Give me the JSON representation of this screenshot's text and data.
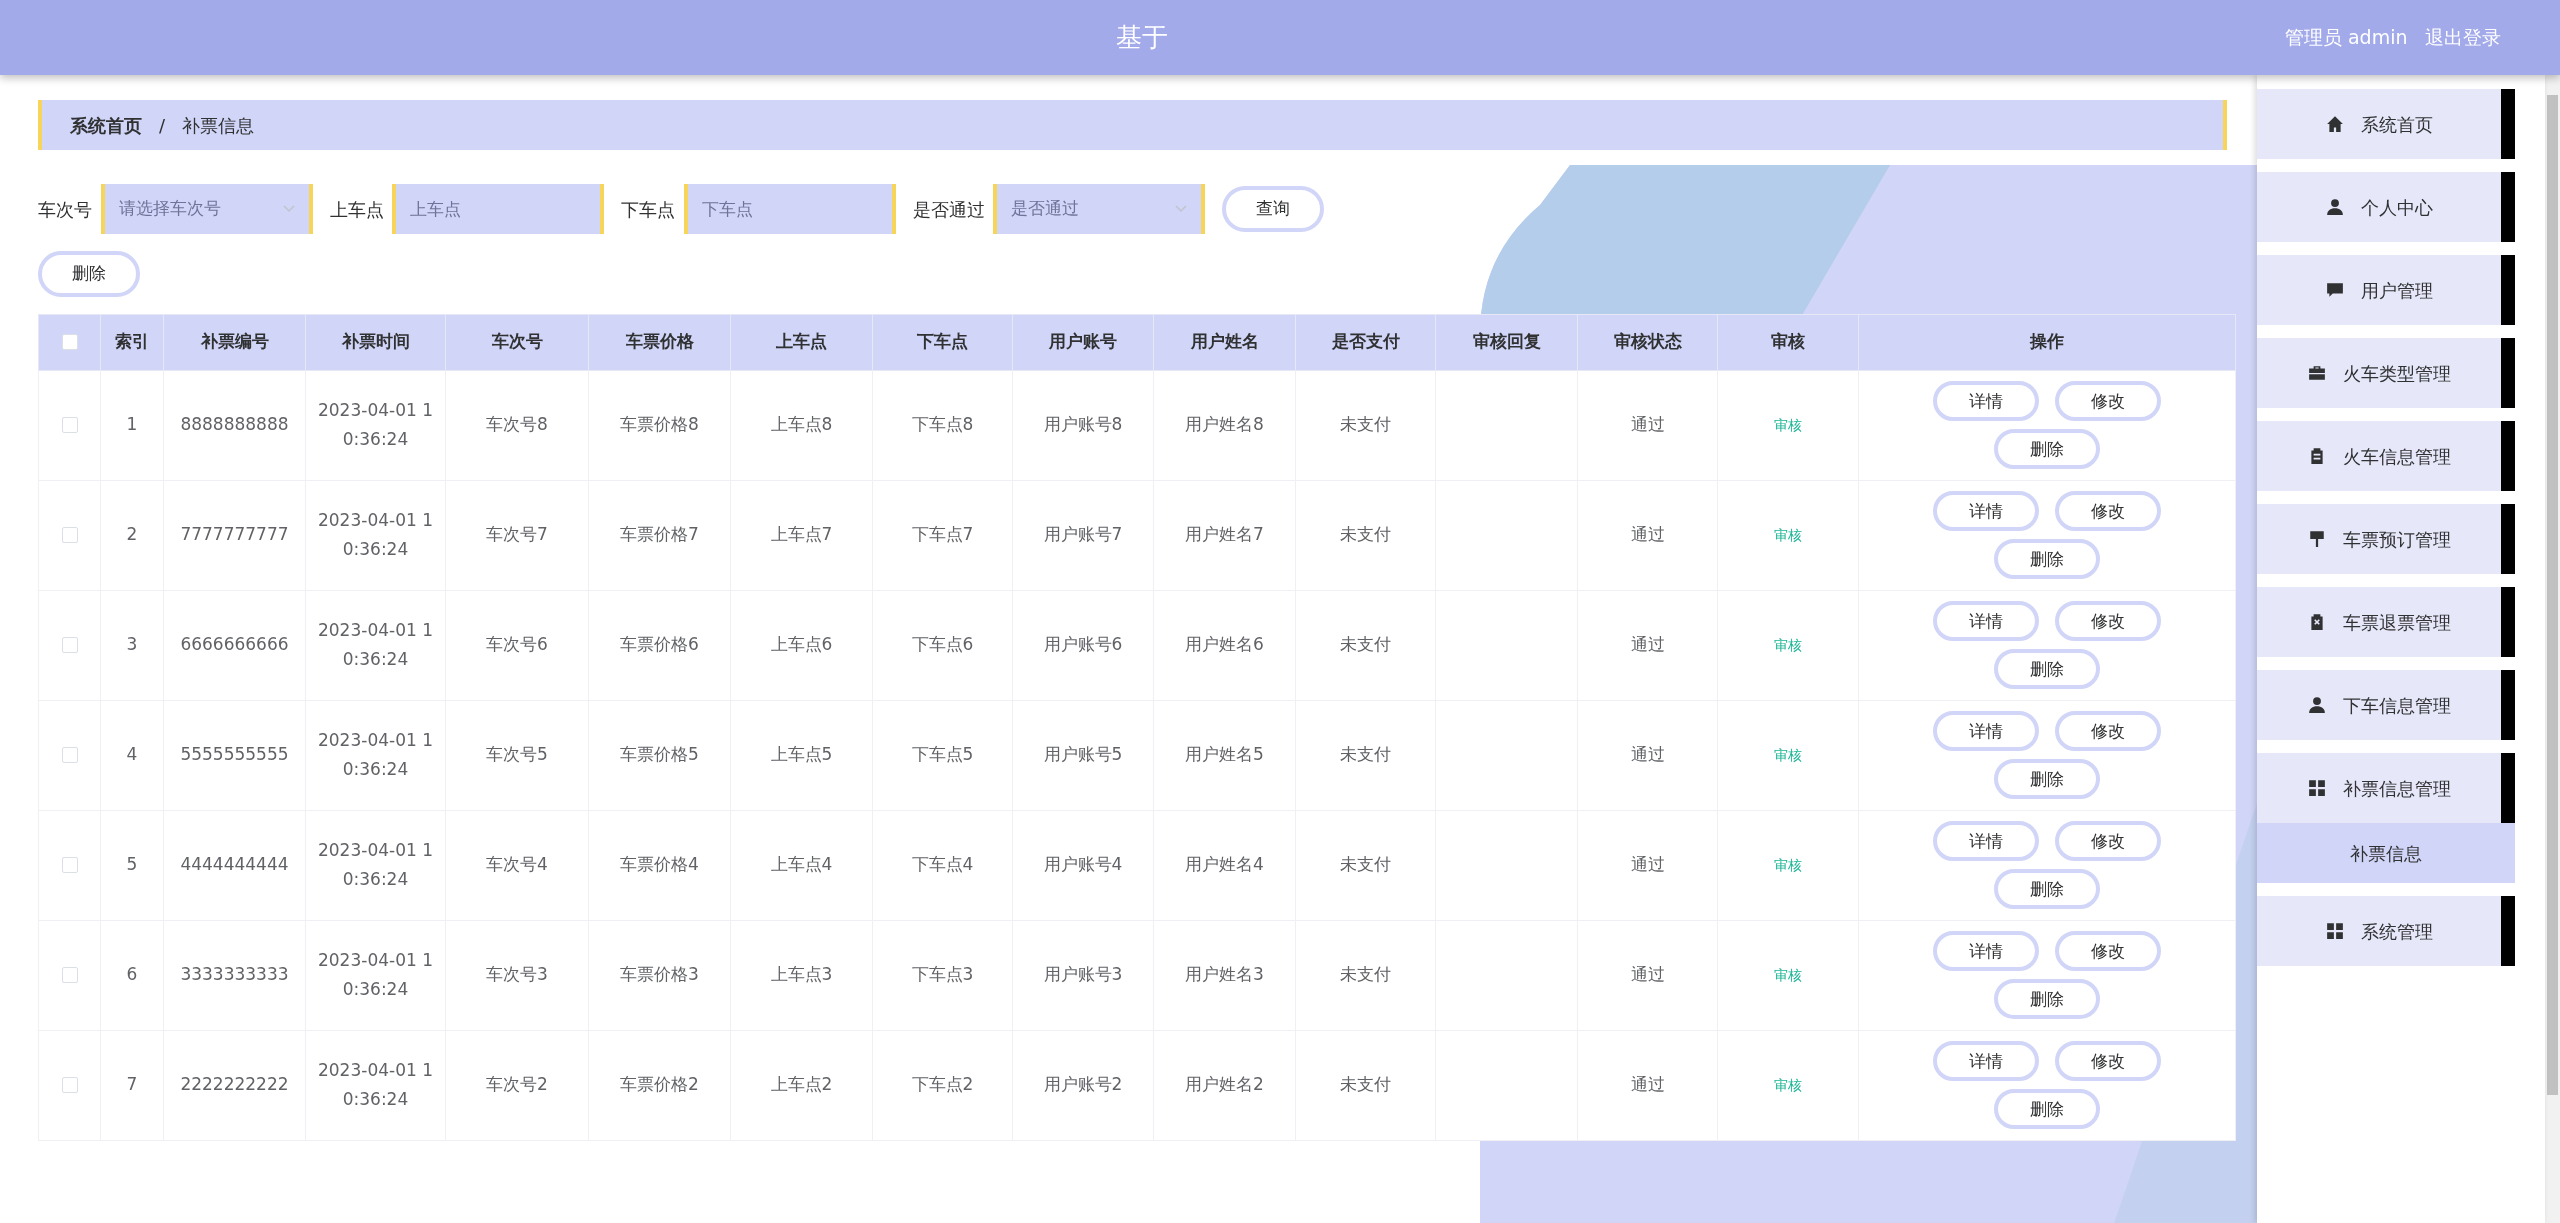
{
  "header": {
    "title": "基于",
    "user_label": "管理员 admin",
    "logout": "退出登录"
  },
  "breadcrumb": [
    {
      "label": "系统首页",
      "current": false
    },
    {
      "label": "补票信息",
      "current": true
    }
  ],
  "breadcrumb_separator": "/",
  "filters": [
    {
      "label": "车次号",
      "kind": "select",
      "placeholder": "请选择车次号"
    },
    {
      "label": "上车点",
      "kind": "input",
      "placeholder": "上车点"
    },
    {
      "label": "下车点",
      "kind": "input",
      "placeholder": "下车点"
    },
    {
      "label": "是否通过",
      "kind": "select",
      "placeholder": "是否通过"
    }
  ],
  "search_button": "查询",
  "delete_button": "删除",
  "table": {
    "select_all": {
      "checked": false
    },
    "columns": [
      "索引",
      "补票编号",
      "补票时间",
      "车次号",
      "车票价格",
      "上车点",
      "下车点",
      "用户账号",
      "用户姓名",
      "是否支付",
      "审核回复",
      "审核状态",
      "审核",
      "操作"
    ],
    "rows": [
      {
        "checked": false,
        "cells": [
          "1",
          "8888888888",
          "2023-04-01 10:36:24",
          "车次号8",
          "车票价格8",
          "上车点8",
          "下车点8",
          "用户账号8",
          "用户姓名8",
          "未支付",
          "",
          "通过"
        ],
        "review_link": "审核",
        "actions": [
          "详情",
          "修改",
          "删除"
        ]
      },
      {
        "checked": false,
        "cells": [
          "2",
          "7777777777",
          "2023-04-01 10:36:24",
          "车次号7",
          "车票价格7",
          "上车点7",
          "下车点7",
          "用户账号7",
          "用户姓名7",
          "未支付",
          "",
          "通过"
        ],
        "review_link": "审核",
        "actions": [
          "详情",
          "修改",
          "删除"
        ]
      },
      {
        "checked": false,
        "cells": [
          "3",
          "6666666666",
          "2023-04-01 10:36:24",
          "车次号6",
          "车票价格6",
          "上车点6",
          "下车点6",
          "用户账号6",
          "用户姓名6",
          "未支付",
          "",
          "通过"
        ],
        "review_link": "审核",
        "actions": [
          "详情",
          "修改",
          "删除"
        ]
      },
      {
        "checked": false,
        "cells": [
          "4",
          "5555555555",
          "2023-04-01 10:36:24",
          "车次号5",
          "车票价格5",
          "上车点5",
          "下车点5",
          "用户账号5",
          "用户姓名5",
          "未支付",
          "",
          "通过"
        ],
        "review_link": "审核",
        "actions": [
          "详情",
          "修改",
          "删除"
        ]
      },
      {
        "checked": false,
        "cells": [
          "5",
          "4444444444",
          "2023-04-01 10:36:24",
          "车次号4",
          "车票价格4",
          "上车点4",
          "下车点4",
          "用户账号4",
          "用户姓名4",
          "未支付",
          "",
          "通过"
        ],
        "review_link": "审核",
        "actions": [
          "详情",
          "修改",
          "删除"
        ]
      },
      {
        "checked": false,
        "cells": [
          "6",
          "3333333333",
          "2023-04-01 10:36:24",
          "车次号3",
          "车票价格3",
          "上车点3",
          "下车点3",
          "用户账号3",
          "用户姓名3",
          "未支付",
          "",
          "通过"
        ],
        "review_link": "审核",
        "actions": [
          "详情",
          "修改",
          "删除"
        ]
      },
      {
        "checked": false,
        "cells": [
          "7",
          "2222222222",
          "2023-04-01 10:36:24",
          "车次号2",
          "车票价格2",
          "上车点2",
          "下车点2",
          "用户账号2",
          "用户姓名2",
          "未支付",
          "",
          "通过"
        ],
        "review_link": "审核",
        "actions": [
          "详情",
          "修改",
          "删除"
        ]
      }
    ]
  },
  "sidebar": {
    "items": [
      {
        "label": "系统首页",
        "expanded": false
      },
      {
        "label": "个人中心",
        "expanded": false
      },
      {
        "label": "用户管理",
        "expanded": false
      },
      {
        "label": "火车类型管理",
        "expanded": false
      },
      {
        "label": "火车信息管理",
        "expanded": false
      },
      {
        "label": "车票预订管理",
        "expanded": false
      },
      {
        "label": "车票退票管理",
        "expanded": false
      },
      {
        "label": "下车信息管理",
        "expanded": false
      },
      {
        "label": "补票信息管理",
        "expanded": true,
        "children": [
          {
            "label": "补票信息",
            "selected": true
          }
        ]
      },
      {
        "label": "系统管理",
        "expanded": false
      }
    ]
  }
}
